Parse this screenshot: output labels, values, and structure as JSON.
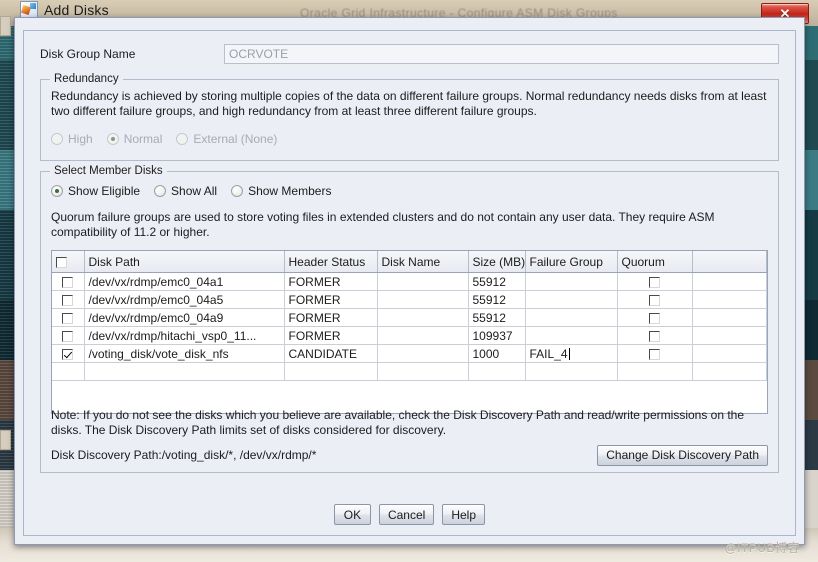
{
  "window": {
    "title": "Add Disks",
    "app_icon": "app-window-icon",
    "close_label": "✕",
    "background_window_title": "Oracle Grid Infrastructure - Configure ASM Disk Groups"
  },
  "disk_group": {
    "label": "Disk Group Name",
    "value": "OCRVOTE",
    "placeholder": "OCRVOTE"
  },
  "redundancy": {
    "legend": "Redundancy",
    "description": "Redundancy is achieved by storing multiple copies of the data on different failure groups. Normal redundancy needs disks from at least two different failure groups, and high redundancy from at least three different failure groups.",
    "options": [
      {
        "label": "High",
        "selected": false,
        "disabled": true
      },
      {
        "label": "Normal",
        "selected": true,
        "disabled": true
      },
      {
        "label": "External (None)",
        "selected": false,
        "disabled": true
      }
    ]
  },
  "member_disks": {
    "legend": "Select Member Disks",
    "filters": [
      {
        "label": "Show Eligible",
        "selected": true
      },
      {
        "label": "Show All",
        "selected": false
      },
      {
        "label": "Show Members",
        "selected": false
      }
    ],
    "quorum_note": "Quorum failure groups are used to store voting files in extended clusters and do not contain any user data. They require ASM compatibility of 11.2 or higher.",
    "columns": [
      "",
      "Disk Path",
      "Header Status",
      "Disk Name",
      "Size (MB)",
      "Failure Group",
      "Quorum"
    ],
    "header_select_all": false,
    "rows": [
      {
        "selected": false,
        "disk_path": "/dev/vx/rdmp/emc0_04a1",
        "header_status": "FORMER",
        "disk_name": "",
        "size_mb": "55912",
        "failure_group": "",
        "quorum": false,
        "editing": false
      },
      {
        "selected": false,
        "disk_path": "/dev/vx/rdmp/emc0_04a5",
        "header_status": "FORMER",
        "disk_name": "",
        "size_mb": "55912",
        "failure_group": "",
        "quorum": false,
        "editing": false
      },
      {
        "selected": false,
        "disk_path": "/dev/vx/rdmp/emc0_04a9",
        "header_status": "FORMER",
        "disk_name": "",
        "size_mb": "55912",
        "failure_group": "",
        "quorum": false,
        "editing": false
      },
      {
        "selected": false,
        "disk_path": "/dev/vx/rdmp/hitachi_vsp0_11...",
        "header_status": "FORMER",
        "disk_name": "",
        "size_mb": "109937",
        "failure_group": "",
        "quorum": false,
        "editing": false
      },
      {
        "selected": true,
        "disk_path": "/voting_disk/vote_disk_nfs",
        "header_status": "CANDIDATE",
        "disk_name": "",
        "size_mb": "1000",
        "failure_group": "FAIL_4",
        "quorum": false,
        "editing": true
      }
    ],
    "note": "Note: If you do not see the disks which you believe are available, check the Disk Discovery Path and read/write permissions on the disks. The Disk Discovery Path limits set of disks considered for discovery.",
    "discovery_path_text": "Disk Discovery Path:/voting_disk/*, /dev/vx/rdmp/*",
    "change_discovery_button": "Change Disk Discovery Path"
  },
  "footer": {
    "ok": "OK",
    "cancel": "Cancel",
    "help": "Help"
  },
  "watermark": "@ITPUB博客",
  "colors": {
    "dialog_bg": "#eceef6",
    "close_red": "#c3251a",
    "radio_selected": "#3d6c3d",
    "border": "#aab6cc"
  }
}
